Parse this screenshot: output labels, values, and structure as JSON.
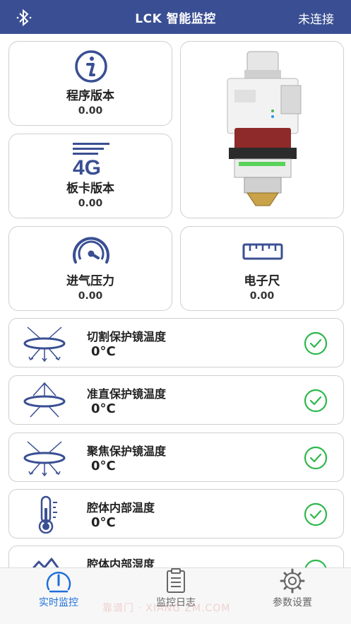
{
  "header": {
    "title": "LCK 智能监控",
    "status": "未连接"
  },
  "cards": {
    "program_version": {
      "label": "程序版本",
      "value": "0.00"
    },
    "board_version": {
      "label": "板卡版本",
      "value": "0.00",
      "icon_text": "4G"
    },
    "intake_pressure": {
      "label": "进气压力",
      "value": "0.00"
    },
    "electronic_ruler": {
      "label": "电子尺",
      "value": "0.00"
    }
  },
  "rows": [
    {
      "label": "切割保护镜温度",
      "value": "0°C",
      "icon": "lens-arrows-down-icon"
    },
    {
      "label": "准直保护镜温度",
      "value": "0°C",
      "icon": "lens-arrows-up-icon"
    },
    {
      "label": "聚焦保护镜温度",
      "value": "0°C",
      "icon": "lens-arrows-down-icon"
    },
    {
      "label": "腔体内部温度",
      "value": "0°C",
      "icon": "thermometer-icon"
    },
    {
      "label": "腔体内部湿度",
      "value": "",
      "icon": "humidity-icon"
    }
  ],
  "tabs": [
    {
      "label": "实时监控",
      "icon": "gauge-icon",
      "active": true
    },
    {
      "label": "监控日志",
      "icon": "clipboard-icon",
      "active": false
    },
    {
      "label": "参数设置",
      "icon": "gear-icon",
      "active": false
    }
  ],
  "watermark": "靠谱门 · XIANG ZM.COM",
  "colors": {
    "header": "#3a4f93",
    "icon_blue": "#3a4f93",
    "check_green": "#2db84d",
    "tab_active": "#1e6fd9",
    "tab_inactive": "#666666"
  }
}
